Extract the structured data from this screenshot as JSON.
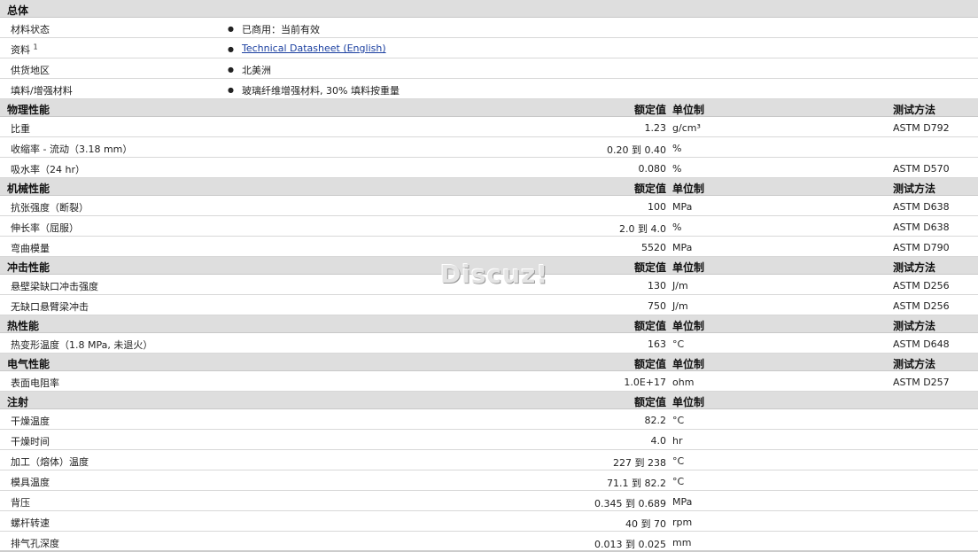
{
  "general": {
    "title": "总体",
    "rows": [
      {
        "name": "材料状态",
        "value": "已商用：当前有效"
      },
      {
        "name": "资料",
        "sup": "1",
        "value": "Technical Datasheet (English)",
        "is_link": true
      },
      {
        "name": "供货地区",
        "value": "北美洲"
      },
      {
        "name": "填料/增强材料",
        "value": "玻璃纤维增强材料, 30% 填料按重量"
      }
    ]
  },
  "headers": {
    "nominal": "额定值",
    "unit": "单位制",
    "method": "测试方法"
  },
  "sections": [
    {
      "title": "物理性能",
      "show_method": true,
      "rows": [
        {
          "name": "比重",
          "value": "1.23",
          "unit": "g/cm³",
          "method": "ASTM D792"
        },
        {
          "name": "收缩率 - 流动（3.18 mm）",
          "value": "0.20 到  0.40",
          "unit": "%",
          "method": ""
        },
        {
          "name": "吸水率（24 hr）",
          "value": "0.080",
          "unit": "%",
          "method": "ASTM D570"
        }
      ]
    },
    {
      "title": "机械性能",
      "show_method": true,
      "rows": [
        {
          "name": "抗张强度（断裂）",
          "value": "100",
          "unit": "MPa",
          "method": "ASTM D638"
        },
        {
          "name": "伸长率（屈服）",
          "value": "2.0 到  4.0",
          "unit": "%",
          "method": "ASTM D638"
        },
        {
          "name": "弯曲模量",
          "value": "5520",
          "unit": "MPa",
          "method": "ASTM D790"
        }
      ]
    },
    {
      "title": "冲击性能",
      "show_method": true,
      "rows": [
        {
          "name": "悬壁梁缺口冲击强度",
          "value": "130",
          "unit": "J/m",
          "method": "ASTM D256"
        },
        {
          "name": "无缺口悬臂梁冲击",
          "value": "750",
          "unit": "J/m",
          "method": "ASTM D256"
        }
      ]
    },
    {
      "title": "热性能",
      "show_method": true,
      "rows": [
        {
          "name": "热变形温度（1.8 MPa, 未退火）",
          "value": "163",
          "unit": "°C",
          "method": "ASTM D648"
        }
      ]
    },
    {
      "title": "电气性能",
      "show_method": true,
      "rows": [
        {
          "name": "表面电阻率",
          "value": "1.0E+17",
          "unit": "ohm",
          "method": "ASTM D257"
        }
      ]
    },
    {
      "title": "注射",
      "show_method": false,
      "rows": [
        {
          "name": "干燥温度",
          "value": "82.2",
          "unit": "°C",
          "method": ""
        },
        {
          "name": "干燥时间",
          "value": "4.0",
          "unit": "hr",
          "method": ""
        },
        {
          "name": "加工（熔体）温度",
          "value": "227 到  238",
          "unit": "°C",
          "method": ""
        },
        {
          "name": "模具温度",
          "value": "71.1 到  82.2",
          "unit": "°C",
          "method": ""
        },
        {
          "name": "背压",
          "value": "0.345 到  0.689",
          "unit": "MPa",
          "method": ""
        },
        {
          "name": "螺杆转速",
          "value": "40 到  70",
          "unit": "rpm",
          "method": ""
        },
        {
          "name": "排气孔深度",
          "value": "0.013 到  0.025",
          "unit": "mm",
          "method": ""
        }
      ]
    }
  ],
  "watermark": "Discuz!"
}
